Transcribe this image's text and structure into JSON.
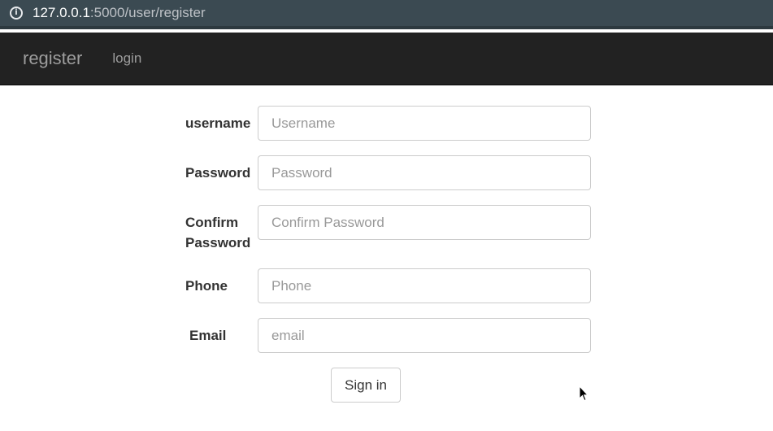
{
  "browser": {
    "url_host": "127.0.0.1",
    "url_rest": ":5000/user/register"
  },
  "navbar": {
    "brand": "register",
    "links": [
      {
        "label": "login"
      }
    ]
  },
  "form": {
    "fields": [
      {
        "label": "username",
        "placeholder": "Username",
        "value": ""
      },
      {
        "label": "Password",
        "placeholder": "Password",
        "value": ""
      },
      {
        "label_line1": "Confirm",
        "label_line2": "Password",
        "placeholder": "Confirm Password",
        "value": ""
      },
      {
        "label": "Phone",
        "placeholder": "Phone",
        "value": ""
      },
      {
        "label": "Email",
        "placeholder": "email",
        "value": ""
      }
    ],
    "submit_label": "Sign in"
  }
}
